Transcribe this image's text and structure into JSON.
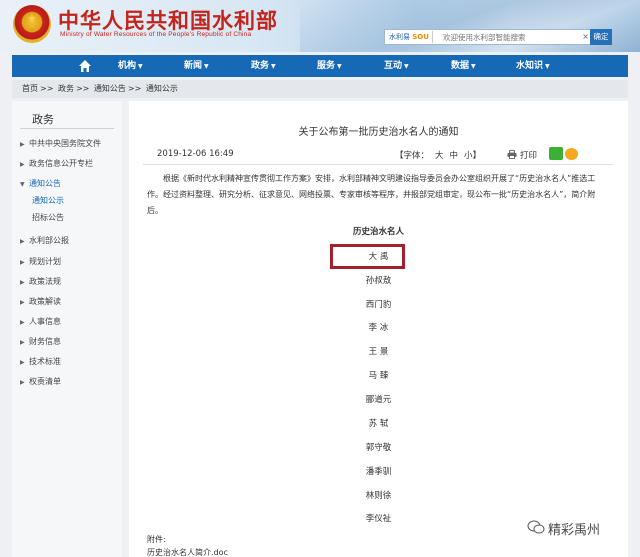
{
  "header": {
    "title": "中华人民共和国水利部",
    "subtitle": "Ministry of Water Resources of the People's Republic of China",
    "search": {
      "tag_prefix": "水利",
      "tag_middle": "易",
      "tag_suffix": "SOU",
      "placeholder": "欢迎使用水利部智能搜索",
      "clear_label": "×",
      "button_label": "确定"
    }
  },
  "nav": {
    "items": [
      {
        "label": "机构"
      },
      {
        "label": "新闻"
      },
      {
        "label": "政务"
      },
      {
        "label": "服务"
      },
      {
        "label": "互动"
      },
      {
        "label": "数据"
      },
      {
        "label": "水知识"
      }
    ]
  },
  "breadcrumb": [
    "首页",
    "政务",
    "通知公告",
    "通知公示"
  ],
  "breadcrumb_separator": ">>",
  "sidebar": {
    "title": "政务",
    "items": [
      {
        "label": "中共中央国务院文件"
      },
      {
        "label": "政务信息公开专栏"
      },
      {
        "label": "通知公告"
      },
      {
        "label": "水利部公报"
      },
      {
        "label": "规划计划"
      },
      {
        "label": "政策法规"
      },
      {
        "label": "政策解读"
      },
      {
        "label": "人事信息"
      },
      {
        "label": "财务信息"
      },
      {
        "label": "技术标准"
      },
      {
        "label": "权责清单"
      }
    ],
    "subitems": [
      {
        "label": "通知公示"
      },
      {
        "label": "招标公告"
      }
    ]
  },
  "article": {
    "title": "关于公布第一批历史治水名人的通知",
    "date": "2019-12-06 16:49",
    "font_label": "【字体：",
    "font_large": "大",
    "font_medium": "中",
    "font_small": "小",
    "font_close": "】",
    "print_label": "打印",
    "body": "根据《新时代水利精神宣传贯彻工作方案》安排，水利部精神文明建设指导委员会办公室组织开展了“历史治水名人”推选工作。经过资料整理、研究分析、征求意见、网络投票、专家审核等程序，并报部党组审定，现公布一批“历史治水名人”，简介附后。",
    "list_heading": "历史治水名人",
    "names": [
      "大  禹",
      "孙叔敖",
      "西门豹",
      "李  冰",
      "王  景",
      "马  臻",
      "郦道元",
      "苏  轼",
      "郭守敬",
      "潘季驯",
      "林则徐",
      "李仪祉"
    ],
    "attachment_label": "附件:",
    "attachment_file": "历史治水名人简介.doc"
  },
  "watermark": "精彩禹州",
  "colors": {
    "brand_red": "#c3241b",
    "nav_blue": "#1669b5",
    "highlight": "#a4202a"
  }
}
